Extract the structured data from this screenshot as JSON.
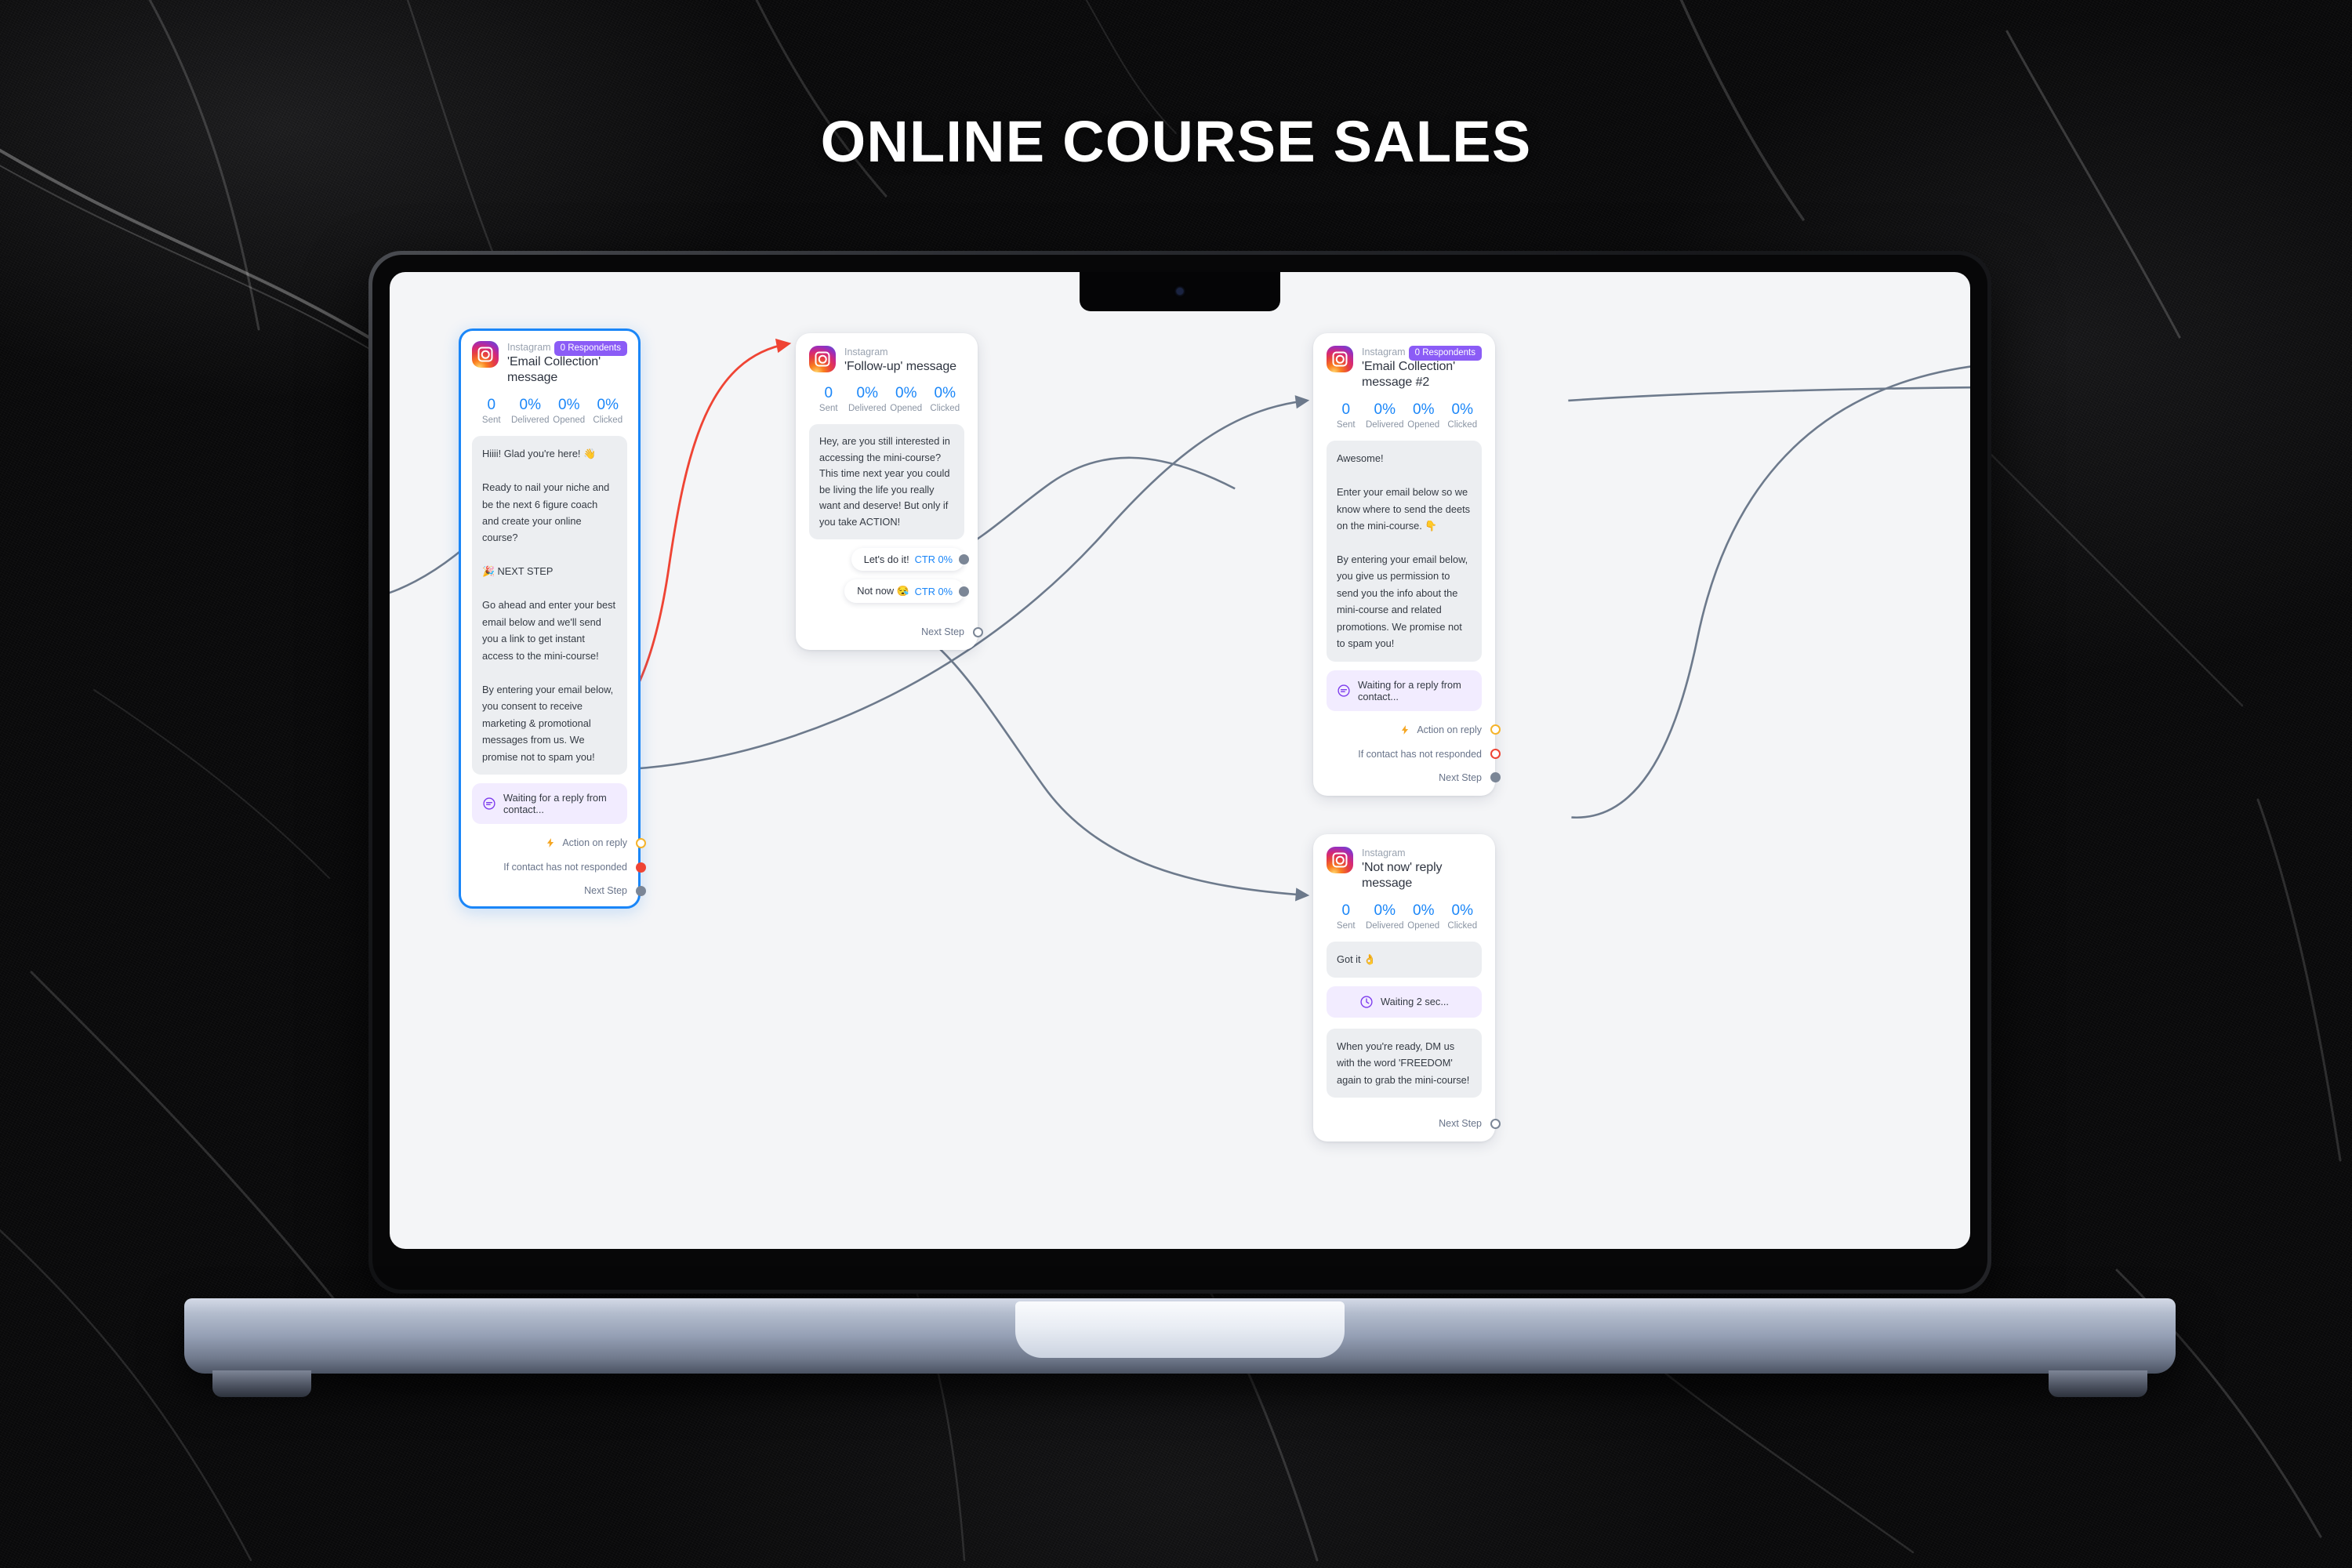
{
  "heading": "ONLINE COURSE SALES",
  "device": {
    "name": "laptop-mockup"
  },
  "flow": {
    "cards": [
      {
        "id": "email-collection-1",
        "platform": "Instagram",
        "title": "'Email Collection' message",
        "badge": "0 Respondents",
        "selected": true,
        "stats": [
          {
            "value": "0",
            "label": "Sent"
          },
          {
            "value": "0%",
            "label": "Delivered"
          },
          {
            "value": "0%",
            "label": "Opened"
          },
          {
            "value": "0%",
            "label": "Clicked"
          }
        ],
        "bubble": "Hiiii! Glad you're here! 👋\n\nReady to nail your niche and be the next 6 figure coach and create your online course?\n\n🎉 NEXT STEP\n\nGo ahead and enter your best email below and we'll send you a link to get instant access to the mini-course!\n\nBy entering your email below, you consent to receive marketing & promotional messages from us. We promise not to spam you!",
        "wait_label": "Waiting for a reply from contact...",
        "outputs": [
          {
            "label": "Action on reply",
            "icon": "bolt-icon",
            "port": "ring-amber"
          },
          {
            "label": "If contact has not responded",
            "icon": "",
            "port": "solid-red"
          },
          {
            "label": "Next Step",
            "icon": "",
            "port": "solid-gray"
          }
        ]
      },
      {
        "id": "follow-up",
        "platform": "Instagram",
        "title": "'Follow-up' message",
        "badge": "",
        "selected": false,
        "stats": [
          {
            "value": "0",
            "label": "Sent"
          },
          {
            "value": "0%",
            "label": "Delivered"
          },
          {
            "value": "0%",
            "label": "Opened"
          },
          {
            "value": "0%",
            "label": "Clicked"
          }
        ],
        "bubble": "Hey, are you still interested in accessing the mini-course? This time next year you could be living the life you really want and deserve! But only if you take ACTION!",
        "buttons": [
          {
            "label": "Let's do it!",
            "ctr": "CTR 0%",
            "port": "solid-gray"
          },
          {
            "label": "Not now 😪",
            "ctr": "CTR 0%",
            "port": "solid-gray"
          }
        ],
        "outputs": [
          {
            "label": "Next Step",
            "icon": "",
            "port": "ring-gray"
          }
        ]
      },
      {
        "id": "email-collection-2",
        "platform": "Instagram",
        "title": "'Email Collection' message #2",
        "badge": "0 Respondents",
        "selected": false,
        "stats": [
          {
            "value": "0",
            "label": "Sent"
          },
          {
            "value": "0%",
            "label": "Delivered"
          },
          {
            "value": "0%",
            "label": "Opened"
          },
          {
            "value": "0%",
            "label": "Clicked"
          }
        ],
        "bubble": "Awesome!\n\nEnter your email below so we know where to send the deets on the mini-course. 👇\n\nBy entering your email below, you give us permission to send you the info about the mini-course and related promotions. We promise not to spam you!",
        "wait_label": "Waiting for a reply from contact...",
        "outputs": [
          {
            "label": "Action on reply",
            "icon": "bolt-icon",
            "port": "ring-amber"
          },
          {
            "label": "If contact has not responded",
            "icon": "",
            "port": "ring-red"
          },
          {
            "label": "Next Step",
            "icon": "",
            "port": "solid-gray"
          }
        ]
      },
      {
        "id": "not-now-reply",
        "platform": "Instagram",
        "title": "'Not now' reply message",
        "badge": "",
        "selected": false,
        "stats": [
          {
            "value": "0",
            "label": "Sent"
          },
          {
            "value": "0%",
            "label": "Delivered"
          },
          {
            "value": "0%",
            "label": "Opened"
          },
          {
            "value": "0%",
            "label": "Clicked"
          }
        ],
        "bubble": "Got it 👌",
        "delay_label": "Waiting 2 sec...",
        "bubble2": "When you're ready, DM us with the word 'FREEDOM' again to grab the mini-course!",
        "outputs": [
          {
            "label": "Next Step",
            "icon": "",
            "port": "ring-gray"
          }
        ]
      }
    ],
    "colors": {
      "accent_blue": "#1a86f8",
      "badge_purple": "#8b5cf6",
      "edge_gray": "#6d7a8c",
      "edge_red": "#ef4434",
      "port_amber": "#f5b32a",
      "canvas_bg": "#f4f5f7"
    }
  }
}
